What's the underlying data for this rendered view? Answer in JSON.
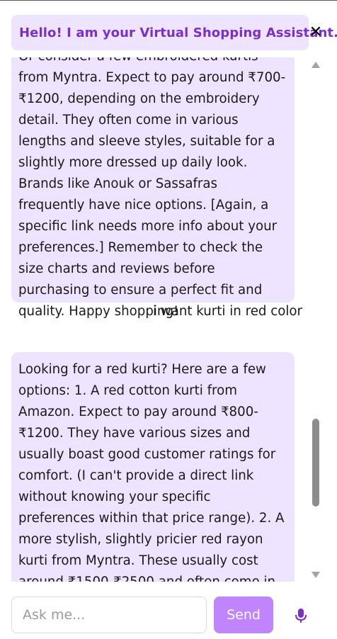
{
  "header": {
    "title": "Hello! I am your Virtual Shopping Assistant."
  },
  "messages": [
    {
      "role": "assistant",
      "text": "Or consider a few embroidered kurtis from Myntra. Expect to pay around ₹700-₹1200, depending on the embroidery detail. They often come in various lengths and sleeve styles, suitable for a slightly more dressed up daily look. Brands like Anouk or Sassafras frequently have nice options. [Again, a specific link needs more info about your preferences.] Remember to check the size charts and reviews before purchasing to ensure a perfect fit and quality. Happy shopping!"
    },
    {
      "role": "user",
      "text": "i want kurti in red color"
    },
    {
      "role": "assistant",
      "text": "Looking for a red kurti? Here are a few options: 1. A red cotton kurti from Amazon. Expect to pay around ₹800-₹1200. They have various sizes and usually boast good customer ratings for comfort. (I can't provide a direct link without knowing your specific preferences within that price range). 2. A more stylish, slightly pricier red rayon kurti from Myntra. These usually cost around ₹1500-₹2500 and often come in various sleeve lengths and"
    }
  ],
  "input": {
    "placeholder": "Ask me...",
    "value": ""
  },
  "send": {
    "label": "Send"
  },
  "icons": {
    "close": "close-icon",
    "mic": "microphone-icon"
  },
  "colors": {
    "accent": "#7b2fc9",
    "bubble": "#efe4ff",
    "send_button": "#c084fc"
  }
}
